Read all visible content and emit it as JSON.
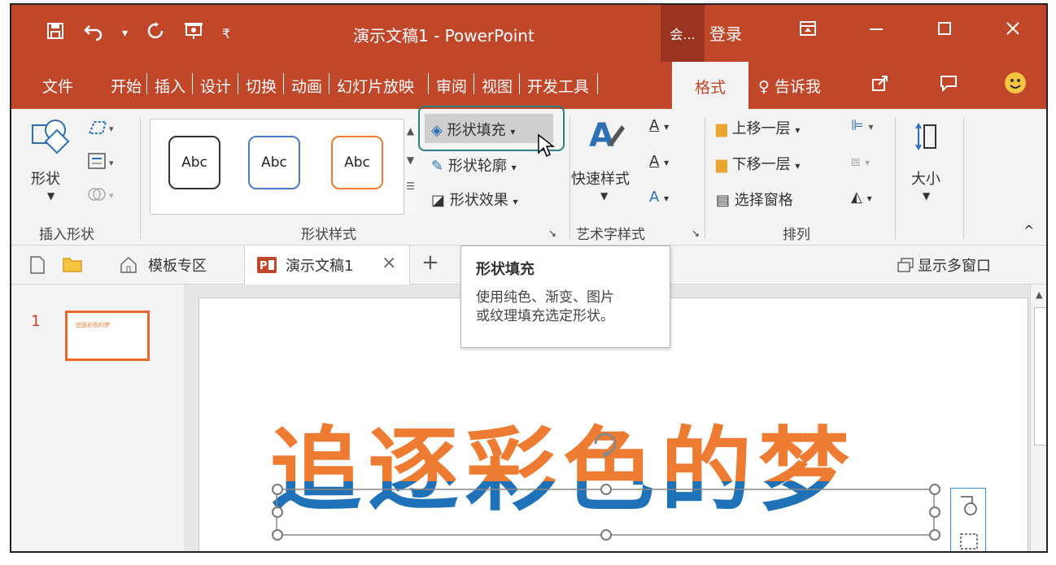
{
  "titlebar": {
    "title": "演示文稿1 - PowerPoint",
    "hui_label": "会...",
    "login": "登录"
  },
  "menu": {
    "items": [
      "文件",
      "开始",
      "插入",
      "设计",
      "切换",
      "动画",
      "幻灯片放映",
      "审阅",
      "视图",
      "开发工具",
      "格式"
    ],
    "tell_me": "告诉我"
  },
  "ribbon": {
    "shape_label": "形状",
    "insert_shape_group": "插入形状",
    "gallery_items": [
      "Abc",
      "Abc",
      "Abc"
    ],
    "shape_style_group": "形状样式",
    "shape_fill": "形状填充",
    "shape_outline": "形状轮廓",
    "shape_effect": "形状效果",
    "quick_style": "快速样式",
    "art_text_group": "艺术字样式",
    "bring_forward": "上移一层",
    "send_backward": "下移一层",
    "selection_pane": "选择窗格",
    "arrange_group": "排列",
    "size_label": "大小"
  },
  "tabstrip": {
    "template_zone": "模板专区",
    "doc_tab": "演示文稿1",
    "multi_window": "显示多窗口"
  },
  "tooltip": {
    "title": "形状填充",
    "body_line1": "使用纯色、渐变、图片",
    "body_line2": "或纹理填充选定形状。"
  },
  "slides": {
    "number": "1",
    "thumb_text": "追逐彩色的梦"
  },
  "slide": {
    "big_text": "追逐彩色的梦"
  },
  "colors": {
    "accent": "#c1472a",
    "orange": "#ee7b32",
    "blue": "#1f72b8",
    "teal_highlight": "#2e7d83"
  }
}
